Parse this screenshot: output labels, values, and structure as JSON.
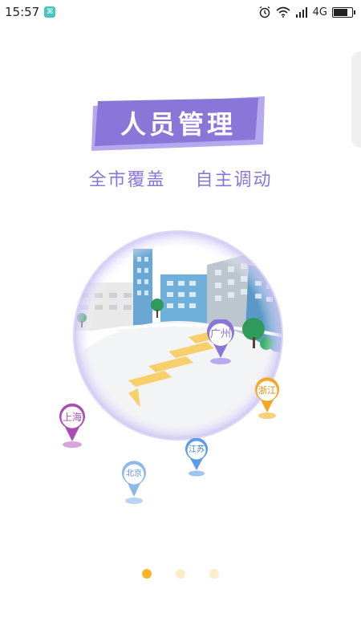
{
  "status_bar": {
    "time": "15:57",
    "network": "4G",
    "icons": [
      "app-notification-icon",
      "alarm-icon",
      "wifi-icon",
      "signal-icon",
      "battery-icon"
    ]
  },
  "onboarding": {
    "title": "人员管理",
    "subtitle_left": "全市覆盖",
    "subtitle_right": "自主调动",
    "colors": {
      "accent": "#8a76d9",
      "active_dot": "#f9b42a",
      "inactive_dot": "#fdecc8"
    }
  },
  "map_pins": {
    "guangzhou": "广州",
    "zhejiang": "浙江",
    "shanghai": "上海",
    "jiangsu": "江苏",
    "beijing": "北京"
  },
  "pager": {
    "page_count": 3,
    "current_page": 1
  }
}
